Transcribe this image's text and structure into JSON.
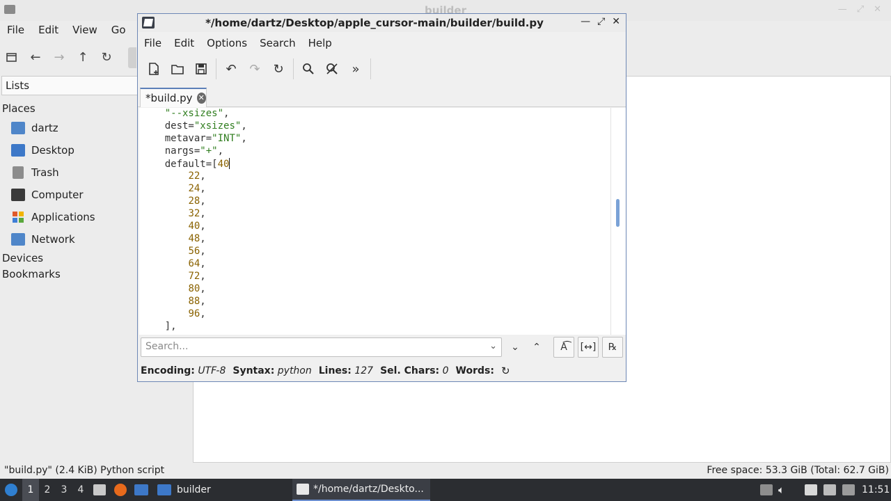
{
  "file_manager": {
    "title": "builder",
    "menus": [
      "File",
      "Edit",
      "View",
      "Go"
    ],
    "side_combo": "Lists",
    "places_heading": "Places",
    "places": [
      {
        "label": "dartz",
        "icon": "home-folder-icon"
      },
      {
        "label": "Desktop",
        "icon": "desktop-icon"
      },
      {
        "label": "Trash",
        "icon": "trash-icon"
      },
      {
        "label": "Computer",
        "icon": "computer-icon"
      },
      {
        "label": "Applications",
        "icon": "applications-icon"
      },
      {
        "label": "Network",
        "icon": "network-icon"
      }
    ],
    "devices_heading": "Devices",
    "bookmarks_heading": "Bookmarks",
    "status_left": "\"build.py\" (2.4 KiB) Python script",
    "status_right": "Free space: 53.3 GiB (Total: 62.7 GiB)"
  },
  "editor": {
    "title": "*/home/dartz/Desktop/apple_cursor-main/builder/build.py",
    "menus": [
      "File",
      "Edit",
      "Options",
      "Search",
      "Help"
    ],
    "tab_label": "*build.py",
    "search_placeholder": "Search...",
    "status": {
      "encoding_label": "Encoding:",
      "encoding": "UTF-8",
      "syntax_label": "Syntax:",
      "syntax": "python",
      "lines_label": "Lines:",
      "lines": "127",
      "sel_label": "Sel. Chars:",
      "sel": "0",
      "words_label": "Words:"
    },
    "code": [
      {
        "indent": "    ",
        "parts": [
          {
            "t": "\"--xsizes\"",
            "c": "str"
          },
          {
            "t": ",",
            "c": ""
          }
        ]
      },
      {
        "indent": "    ",
        "parts": [
          {
            "t": "dest=",
            "c": ""
          },
          {
            "t": "\"xsizes\"",
            "c": "str"
          },
          {
            "t": ",",
            "c": ""
          }
        ]
      },
      {
        "indent": "    ",
        "parts": [
          {
            "t": "metavar=",
            "c": ""
          },
          {
            "t": "\"INT\"",
            "c": "str"
          },
          {
            "t": ",",
            "c": ""
          }
        ]
      },
      {
        "indent": "    ",
        "parts": [
          {
            "t": "nargs=",
            "c": ""
          },
          {
            "t": "\"+\"",
            "c": "str"
          },
          {
            "t": ",",
            "c": ""
          }
        ]
      },
      {
        "indent": "    ",
        "parts": [
          {
            "t": "default=[",
            "c": ""
          },
          {
            "t": "40",
            "c": "num"
          }
        ],
        "caret": true
      },
      {
        "indent": "        ",
        "parts": [
          {
            "t": "22",
            "c": "num"
          },
          {
            "t": ",",
            "c": ""
          }
        ]
      },
      {
        "indent": "        ",
        "parts": [
          {
            "t": "24",
            "c": "num"
          },
          {
            "t": ",",
            "c": ""
          }
        ]
      },
      {
        "indent": "        ",
        "parts": [
          {
            "t": "28",
            "c": "num"
          },
          {
            "t": ",",
            "c": ""
          }
        ]
      },
      {
        "indent": "        ",
        "parts": [
          {
            "t": "32",
            "c": "num"
          },
          {
            "t": ",",
            "c": ""
          }
        ]
      },
      {
        "indent": "        ",
        "parts": [
          {
            "t": "40",
            "c": "num"
          },
          {
            "t": ",",
            "c": ""
          }
        ]
      },
      {
        "indent": "        ",
        "parts": [
          {
            "t": "48",
            "c": "num"
          },
          {
            "t": ",",
            "c": ""
          }
        ]
      },
      {
        "indent": "        ",
        "parts": [
          {
            "t": "56",
            "c": "num"
          },
          {
            "t": ",",
            "c": ""
          }
        ]
      },
      {
        "indent": "        ",
        "parts": [
          {
            "t": "64",
            "c": "num"
          },
          {
            "t": ",",
            "c": ""
          }
        ]
      },
      {
        "indent": "        ",
        "parts": [
          {
            "t": "72",
            "c": "num"
          },
          {
            "t": ",",
            "c": ""
          }
        ]
      },
      {
        "indent": "        ",
        "parts": [
          {
            "t": "80",
            "c": "num"
          },
          {
            "t": ",",
            "c": ""
          }
        ]
      },
      {
        "indent": "        ",
        "parts": [
          {
            "t": "88",
            "c": "num"
          },
          {
            "t": ",",
            "c": ""
          }
        ]
      },
      {
        "indent": "        ",
        "parts": [
          {
            "t": "96",
            "c": "num"
          },
          {
            "t": ",",
            "c": ""
          }
        ]
      },
      {
        "indent": "    ",
        "parts": [
          {
            "t": "],",
            "c": ""
          }
        ]
      }
    ]
  },
  "taskbar": {
    "workspaces": [
      "1",
      "2",
      "3",
      "4"
    ],
    "folder_task": "builder",
    "editor_task": "*/home/dartz/Deskto...",
    "clock": "11:51"
  }
}
